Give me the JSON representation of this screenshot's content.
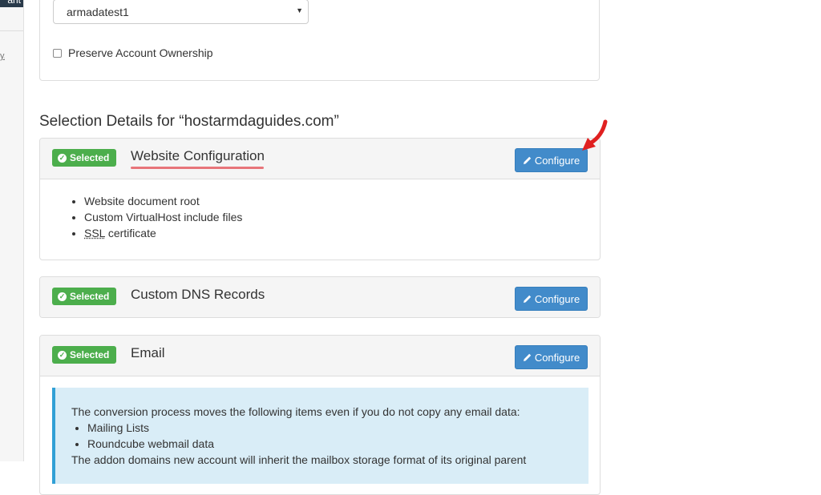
{
  "sidebar": {
    "top_text": "ant",
    "fragment": "y."
  },
  "account": {
    "selected": "armadatest1"
  },
  "preserve": {
    "label": "Preserve Account Ownership"
  },
  "selection": {
    "heading": "Selection Details for “hostarmdaguides.com”"
  },
  "website_config": {
    "badge": "Selected",
    "title": "Website Configuration",
    "button": "Configure",
    "items": [
      "Website document root",
      "Custom VirtualHost include files"
    ],
    "ssl_abbr": "SSL",
    "ssl_rest": " certificate"
  },
  "dns": {
    "badge": "Selected",
    "title": "Custom DNS Records",
    "button": "Configure"
  },
  "email": {
    "badge": "Selected",
    "title": "Email",
    "button": "Configure",
    "info_lead": "The conversion process moves the following items even if you do not copy any email data:",
    "info_items": [
      "Mailing Lists",
      "Roundcube webmail data"
    ],
    "info_trail": "The addon domains new account will inherit the mailbox storage format of its original parent"
  },
  "colors": {
    "accent": "#428bca",
    "success": "#4cae4c",
    "info_bg": "#d9edf7",
    "annotation": "#e02020"
  }
}
